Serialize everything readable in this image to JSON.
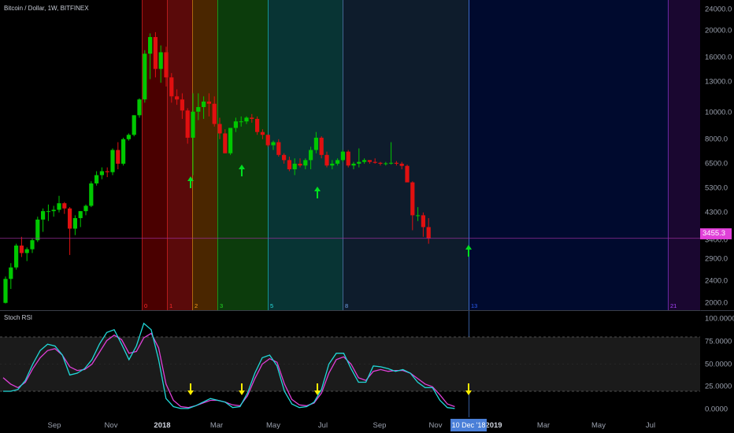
{
  "header": {
    "symbol": "Bitcoin / Dollar, 1W, BITFINEX",
    "rsi_title": "Stoch RSI"
  },
  "colors": {
    "up": "#00c800",
    "down": "#e01010",
    "k_line": "#20d8d8",
    "d_line": "#e040d8",
    "arrow_up": "#00e020",
    "arrow_down": "#ffee00",
    "price_line": "#a030a0"
  },
  "chart_data": {
    "type": "candlestick",
    "price_scale": "log",
    "price_axis_ticks": [
      "24000.0",
      "20000.0",
      "16000.0",
      "13000.0",
      "10000.0",
      "8000.0",
      "6500.0",
      "5300.0",
      "4300.0",
      "3400.0",
      "2900.0",
      "2400.0",
      "2000.0"
    ],
    "time_axis_labels": [
      "Sep",
      "Nov",
      "2018",
      "Mar",
      "May",
      "Jul",
      "Sep",
      "Nov",
      "2019",
      "Mar",
      "May",
      "Jul"
    ],
    "last_price": "3455.3",
    "crosshair_date": "10 Dec '18",
    "fib_time_zones": [
      {
        "label": "0",
        "color": "#ff2a2a"
      },
      {
        "label": "1",
        "color": "#ff2a2a"
      },
      {
        "label": "2",
        "color": "#ff9d1a"
      },
      {
        "label": "3",
        "color": "#22dd22"
      },
      {
        "label": "5",
        "color": "#27dede"
      },
      {
        "label": "8",
        "color": "#6ea2e6"
      },
      {
        "label": "13",
        "color": "#2a5af0"
      },
      {
        "label": "21",
        "color": "#aa44ff"
      }
    ],
    "candles_ohlc": [
      [
        2000,
        2500,
        1990,
        2450
      ],
      [
        2450,
        2800,
        2250,
        2700
      ],
      [
        2700,
        3300,
        2650,
        3250
      ],
      [
        3250,
        3500,
        2950,
        3050
      ],
      [
        3050,
        3200,
        2850,
        3150
      ],
      [
        3150,
        3450,
        3050,
        3400
      ],
      [
        3400,
        4150,
        3350,
        4050
      ],
      [
        4050,
        4450,
        3650,
        4350
      ],
      [
        4350,
        4600,
        4000,
        4350
      ],
      [
        4350,
        4550,
        4150,
        4400
      ],
      [
        4400,
        4950,
        4300,
        4650
      ],
      [
        4650,
        4700,
        4250,
        4450
      ],
      [
        4450,
        4500,
        3000,
        3750
      ],
      [
        3750,
        4200,
        3550,
        4100
      ],
      [
        4100,
        4350,
        3800,
        4350
      ],
      [
        4350,
        4600,
        4200,
        4550
      ],
      [
        4550,
        5600,
        4500,
        5500
      ],
      [
        5500,
        6100,
        5400,
        5900
      ],
      [
        5900,
        6300,
        5700,
        6100
      ],
      [
        6100,
        6300,
        5800,
        6050
      ],
      [
        6050,
        7400,
        5900,
        7300
      ],
      [
        7300,
        7800,
        6200,
        6500
      ],
      [
        6500,
        8100,
        6400,
        8000
      ],
      [
        8000,
        8400,
        7900,
        8300
      ],
      [
        8300,
        9800,
        8200,
        9800
      ],
      [
        9800,
        11300,
        9600,
        11200
      ],
      [
        11200,
        17000,
        10900,
        16500
      ],
      [
        16500,
        19600,
        13300,
        19000
      ],
      [
        19000,
        19800,
        13500,
        14500
      ],
      [
        14500,
        17700,
        12900,
        16700
      ],
      [
        16700,
        17500,
        12500,
        13500
      ],
      [
        13500,
        14000,
        10900,
        11500
      ],
      [
        11500,
        12200,
        10700,
        11200
      ],
      [
        11200,
        11800,
        9500,
        10200
      ],
      [
        10200,
        10400,
        7700,
        8100
      ],
      [
        8100,
        11800,
        5900,
        10100
      ],
      [
        10100,
        11800,
        9400,
        10500
      ],
      [
        10500,
        11500,
        9500,
        11000
      ],
      [
        11000,
        11800,
        9700,
        10800
      ],
      [
        10800,
        11500,
        8900,
        9100
      ],
      [
        9100,
        9600,
        8000,
        8400
      ],
      [
        8400,
        8700,
        7100,
        7100
      ],
      [
        7100,
        8700,
        7000,
        8800
      ],
      [
        8800,
        9600,
        8500,
        9300
      ],
      [
        9300,
        9700,
        8900,
        9300
      ],
      [
        9300,
        9700,
        9100,
        9600
      ],
      [
        9600,
        9900,
        9200,
        9500
      ],
      [
        9500,
        9700,
        8300,
        8500
      ],
      [
        8500,
        8700,
        8000,
        8300
      ],
      [
        8300,
        8300,
        7500,
        7600
      ],
      [
        7600,
        7900,
        7300,
        7800
      ],
      [
        7800,
        8000,
        6900,
        7000
      ],
      [
        7000,
        7100,
        6500,
        6700
      ],
      [
        6700,
        6900,
        6100,
        6200
      ],
      [
        6200,
        6800,
        5900,
        6500
      ],
      [
        6500,
        6800,
        6300,
        6400
      ],
      [
        6400,
        6800,
        6200,
        6700
      ],
      [
        6700,
        7500,
        6200,
        7300
      ],
      [
        7300,
        8500,
        7100,
        8100
      ],
      [
        8100,
        8200,
        6800,
        7000
      ],
      [
        7000,
        7200,
        6300,
        6400
      ],
      [
        6400,
        6700,
        6200,
        6500
      ],
      [
        6500,
        6800,
        6400,
        6700
      ],
      [
        6700,
        7300,
        6600,
        7200
      ],
      [
        7200,
        7300,
        6300,
        6400
      ],
      [
        6400,
        6600,
        6200,
        6500
      ],
      [
        6500,
        7400,
        6300,
        6600
      ],
      [
        6600,
        6800,
        6500,
        6700
      ],
      [
        6700,
        6700,
        6500,
        6600
      ],
      [
        6600,
        6800,
        6500,
        6550
      ],
      [
        6550,
        6600,
        6400,
        6500
      ],
      [
        6500,
        6600,
        6400,
        6520
      ],
      [
        6520,
        7800,
        6450,
        6550
      ],
      [
        6550,
        6650,
        6400,
        6500
      ],
      [
        6500,
        6600,
        6200,
        6380
      ],
      [
        6380,
        6450,
        5700,
        5550
      ],
      [
        5550,
        5600,
        3700,
        4200
      ],
      [
        4200,
        4500,
        4000,
        4200
      ],
      [
        4200,
        4300,
        3500,
        3800
      ],
      [
        3800,
        4100,
        3300,
        3455
      ]
    ],
    "stoch_rsi": {
      "axis_ticks": [
        "100.0000",
        "75.0000",
        "50.0000",
        "25.0000",
        "0.0000"
      ],
      "upper_band": 80,
      "lower_band": 20,
      "k": [
        20,
        20,
        22,
        32,
        50,
        65,
        72,
        70,
        60,
        38,
        40,
        45,
        55,
        72,
        85,
        88,
        72,
        55,
        70,
        95,
        88,
        55,
        12,
        3,
        1,
        1,
        4,
        8,
        12,
        10,
        8,
        2,
        3,
        18,
        40,
        57,
        60,
        48,
        20,
        6,
        2,
        3,
        8,
        22,
        50,
        62,
        62,
        45,
        30,
        30,
        48,
        47,
        45,
        42,
        44,
        40,
        30,
        24,
        24,
        10,
        2,
        1
      ],
      "d": [
        35,
        28,
        24,
        30,
        45,
        57,
        65,
        67,
        60,
        47,
        43,
        44,
        50,
        63,
        76,
        82,
        77,
        62,
        64,
        79,
        84,
        68,
        28,
        10,
        3,
        2,
        4,
        7,
        10,
        10,
        8,
        5,
        4,
        15,
        34,
        50,
        56,
        52,
        28,
        11,
        5,
        4,
        7,
        18,
        40,
        55,
        58,
        50,
        35,
        32,
        42,
        44,
        42,
        43,
        43,
        40,
        34,
        28,
        25,
        16,
        6,
        3
      ]
    }
  }
}
